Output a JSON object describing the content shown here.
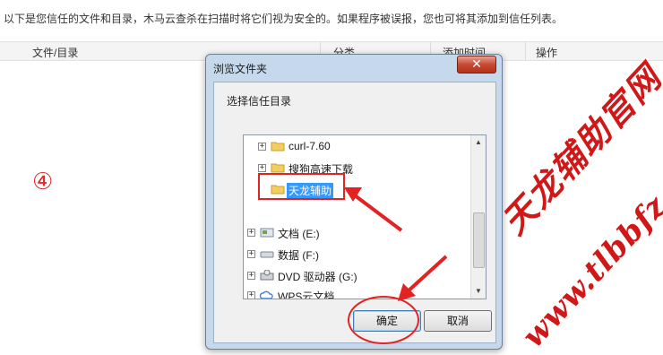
{
  "intro": "以下是您信任的文件和目录，木马云查杀在扫描时将它们视为安全的。如果程序被误报，您也可将其添加到信任列表。",
  "table": {
    "headers": [
      "文件/目录",
      "分类",
      "添加时间",
      "操作"
    ]
  },
  "step_marker": "④",
  "dialog": {
    "title": "浏览文件夹",
    "close_label": "✕",
    "prompt": "选择信任目录",
    "tree": [
      {
        "label": "curl-7.60",
        "icon": "folder-icon",
        "expander": "+"
      },
      {
        "label": "搜狗高速下载",
        "icon": "folder-icon",
        "expander": "+"
      },
      {
        "label": "天龙辅助",
        "icon": "folder-icon",
        "expander": "",
        "selected": true
      },
      {
        "label": "文档 (E:)",
        "icon": "drive-icon",
        "expander": "+"
      },
      {
        "label": "数据 (F:)",
        "icon": "drive-icon",
        "expander": "+"
      },
      {
        "label": "DVD 驱动器 (G:)",
        "icon": "dvd-drive-icon",
        "expander": "+"
      },
      {
        "label": "WPS云文档",
        "icon": "cloud-icon",
        "expander": "+"
      }
    ],
    "ok_label": "确定",
    "cancel_label": "取消"
  },
  "watermark": {
    "line1": "天龙辅助官网",
    "line2": "www.tlbbfz.com",
    "color": "#d11818"
  },
  "colors": {
    "annotation": "#e32222",
    "selection": "#3399ff"
  }
}
